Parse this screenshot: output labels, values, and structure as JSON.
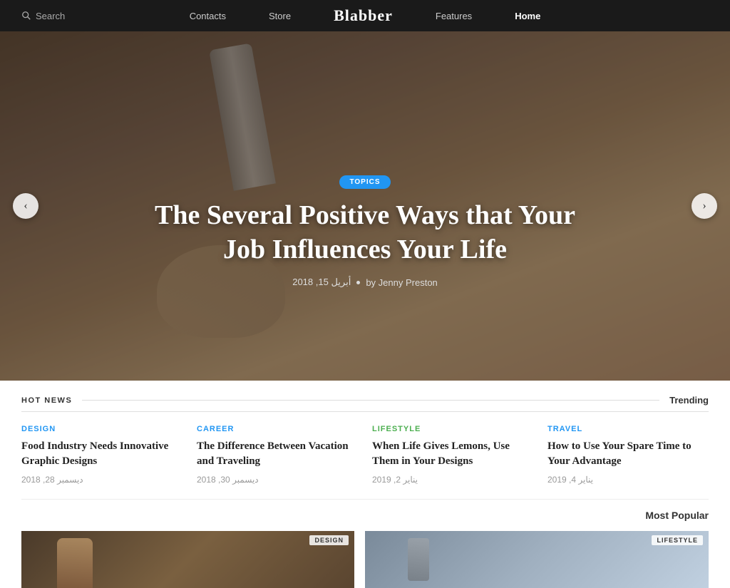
{
  "navbar": {
    "search_placeholder": "Search",
    "links": [
      {
        "label": "Contacts",
        "name": "contacts"
      },
      {
        "label": "Store",
        "name": "store"
      },
      {
        "label": "Features",
        "name": "features"
      },
      {
        "label": "Home",
        "name": "home",
        "active": true
      }
    ],
    "logo": "Blabber"
  },
  "hero": {
    "badge": "TOPICS",
    "title": "The Several Positive Ways that Your Job Influences Your Life",
    "meta_date": "أبريل 15, 2018",
    "meta_by": "by Jenny Preston",
    "arrow_left": "‹",
    "arrow_right": "›"
  },
  "hot_news": {
    "label": "HOT NEWS",
    "trending_label": "Trending"
  },
  "articles": [
    {
      "category": "DESIGN",
      "category_class": "cat-design",
      "title": "Food Industry Needs Innovative Graphic Designs",
      "date": "ديسمبر 28, 2018"
    },
    {
      "category": "CAREER",
      "category_class": "cat-career",
      "title": "The Difference Between Vacation and Traveling",
      "date": "ديسمبر 30, 2018"
    },
    {
      "category": "LIFESTYLE",
      "category_class": "cat-lifestyle",
      "title": "When Life Gives Lemons, Use Them in Your Designs",
      "date": "يناير 2, 2019"
    },
    {
      "category": "TRAVEL",
      "category_class": "cat-travel",
      "title": "How to Use Your Spare Time to Your Advantage",
      "date": "يناير 4, 2019"
    }
  ],
  "most_popular": {
    "label": "Most Popular"
  },
  "bottom_images": [
    {
      "label": "DESIGN"
    },
    {
      "label": "LIFESTYLE"
    }
  ]
}
